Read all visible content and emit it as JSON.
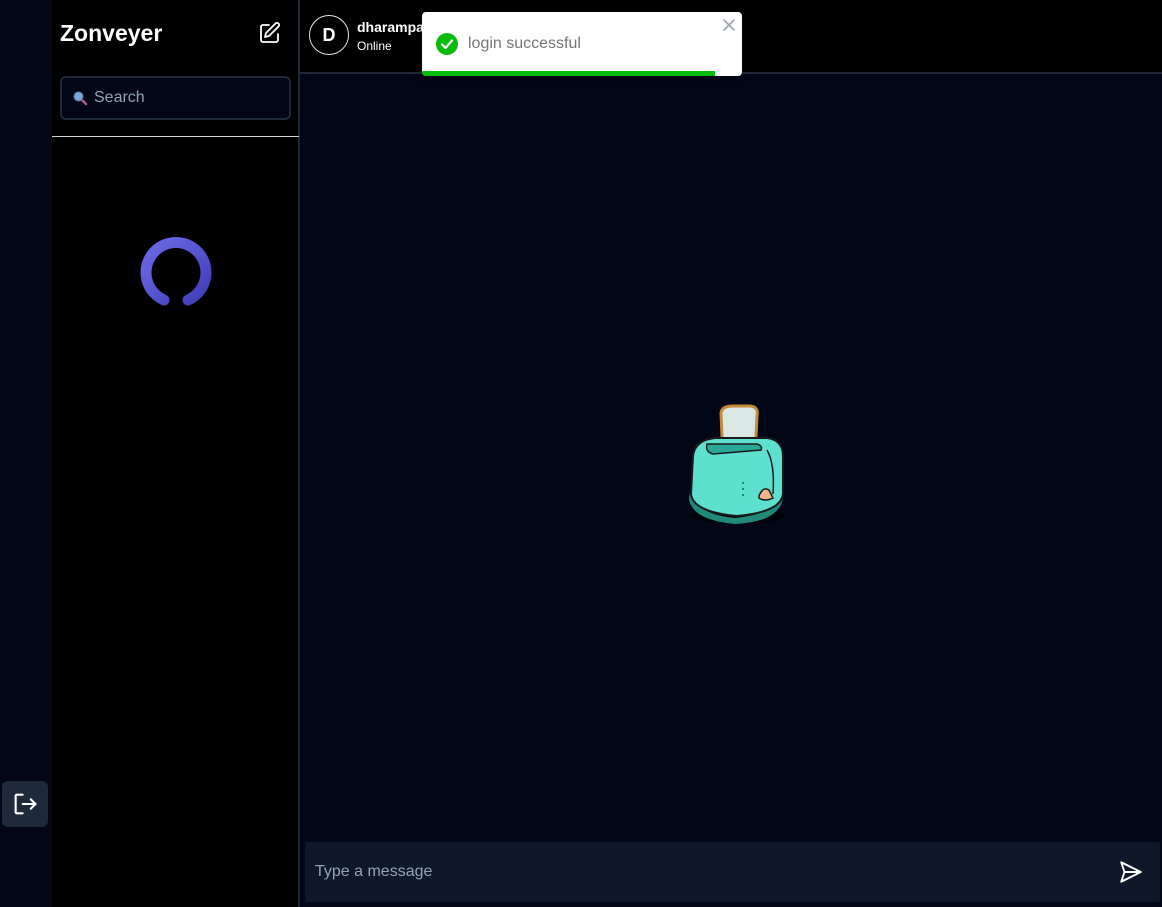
{
  "app": {
    "brand": "Zonveyer"
  },
  "sidebar": {
    "search_placeholder": "Search",
    "edit_icon": "edit-square-icon",
    "search_icon": "search-icon"
  },
  "rail": {
    "logout_icon": "logout-icon"
  },
  "chat": {
    "contact_initial": "D",
    "contact_name": "dharampa",
    "contact_status": "Online",
    "composer_placeholder": "Type a message",
    "send_icon": "send-icon",
    "illustration": "toaster-illustration"
  },
  "toast": {
    "message": "login successful",
    "icon": "check-circle-icon",
    "close_icon": "close-icon",
    "progress_fraction": 0.915,
    "accent": "#07bc0c"
  },
  "colors": {
    "spinner": "#5b5bd6",
    "toaster_body": "#5ee0d1",
    "rail_bg": "#020617",
    "main_bg": "#020617"
  }
}
